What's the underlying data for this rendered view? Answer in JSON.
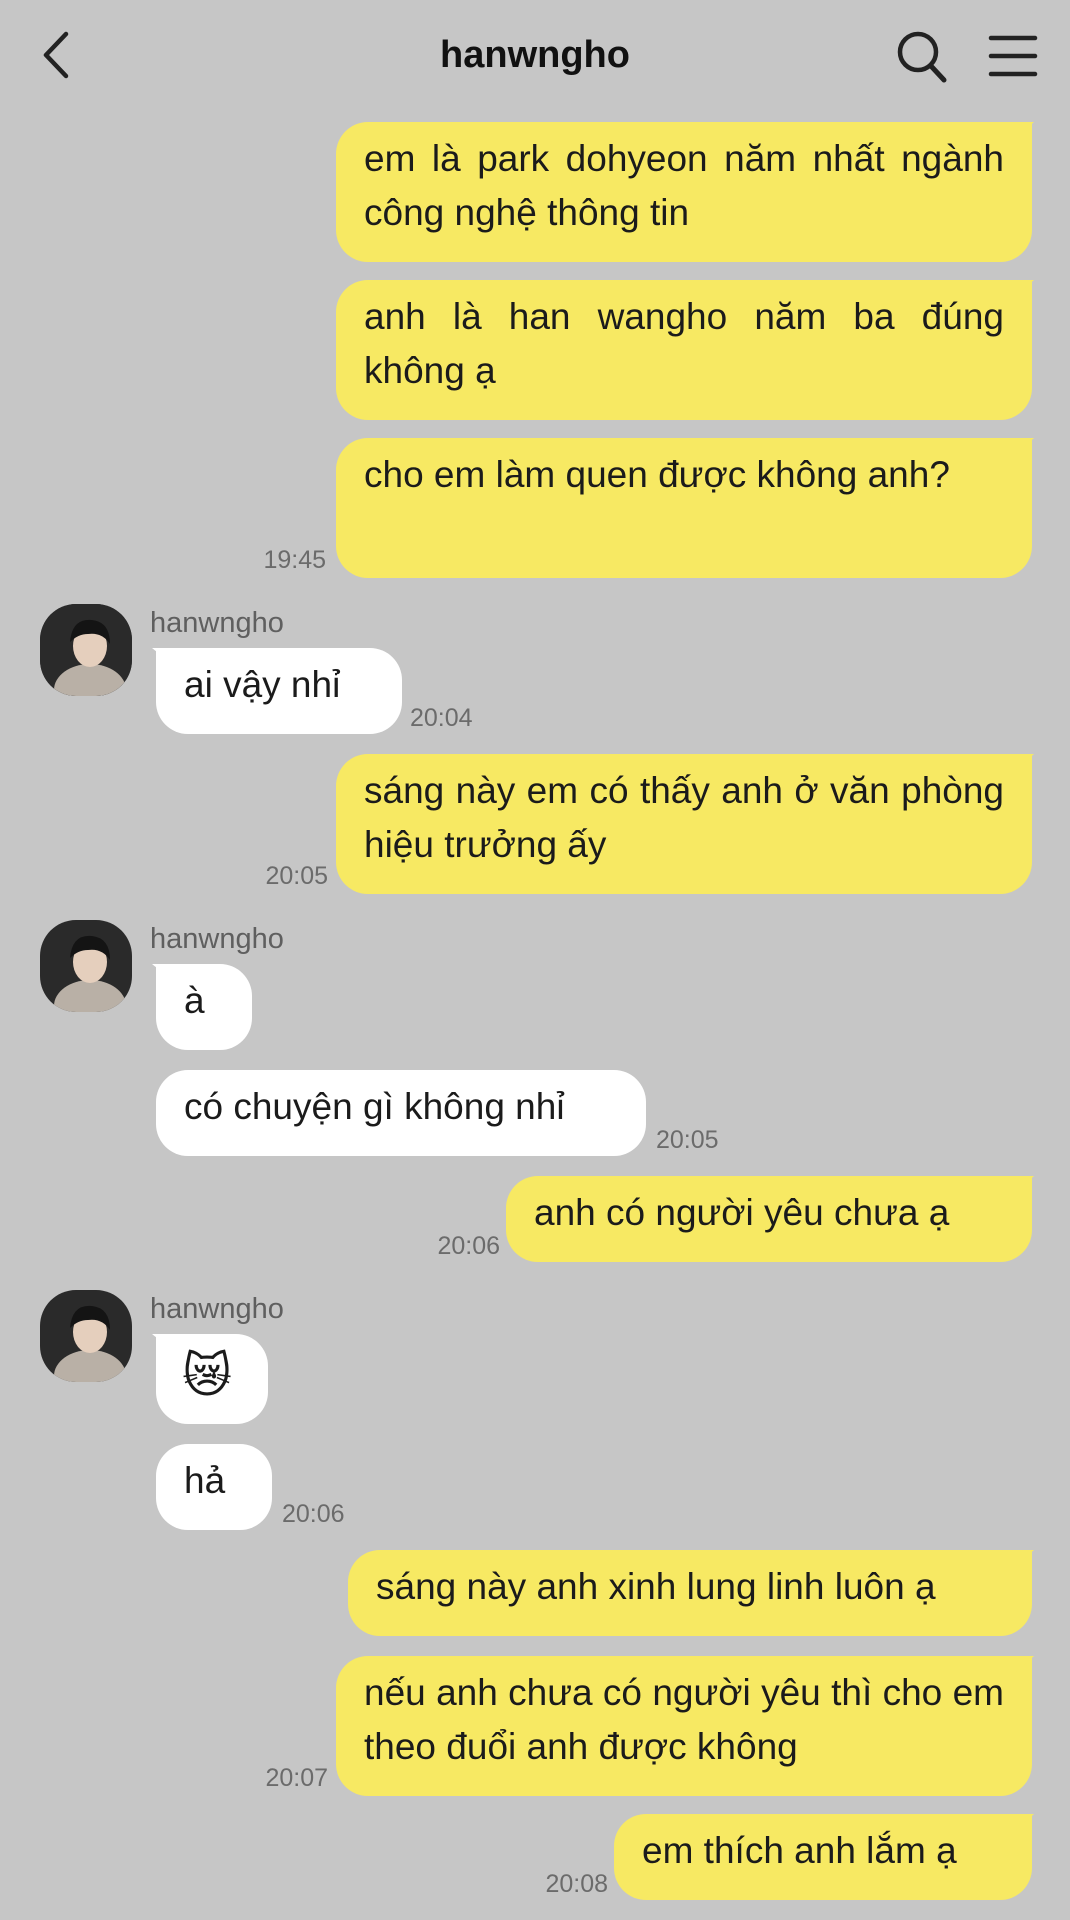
{
  "header": {
    "title": "hanwngho",
    "back_icon": "chevron-left-icon",
    "search_icon": "search-icon",
    "menu_icon": "hamburger-menu-icon"
  },
  "contact": {
    "name": "hanwngho"
  },
  "colors": {
    "background": "#c6c6c6",
    "my_bubble": "#f7e963",
    "their_bubble": "#ffffff",
    "timestamp": "#6b6b6b"
  },
  "messages": [
    {
      "from": "me",
      "text": "em là park dohyeon năm nhất ngành công nghệ thông tin"
    },
    {
      "from": "me",
      "text": "anh là han wangho năm ba đúng không ạ"
    },
    {
      "from": "me",
      "text": "cho em làm quen được không anh?",
      "time": "19:45"
    },
    {
      "from": "them",
      "sender": "hanwngho",
      "text": "ai vậy nhỉ",
      "time": "20:04"
    },
    {
      "from": "me",
      "text": "sáng này em có thấy anh ở văn phòng hiệu trưởng ấy",
      "time": "20:05"
    },
    {
      "from": "them",
      "sender": "hanwngho",
      "text": "à"
    },
    {
      "from": "them",
      "text": "có chuyện gì không nhỉ",
      "time": "20:05"
    },
    {
      "from": "me",
      "text": "anh có người yêu chưa ạ",
      "time": "20:06"
    },
    {
      "from": "them",
      "sender": "hanwngho",
      "text": "😿"
    },
    {
      "from": "them",
      "text": "hả",
      "time": "20:06"
    },
    {
      "from": "me",
      "text": "sáng này anh xinh lung linh luôn ạ"
    },
    {
      "from": "me",
      "text": "nếu anh chưa có người yêu thì cho em theo đuổi anh được không",
      "time": "20:07"
    },
    {
      "from": "me",
      "text": "em thích anh lắm ạ",
      "time": "20:08"
    }
  ]
}
